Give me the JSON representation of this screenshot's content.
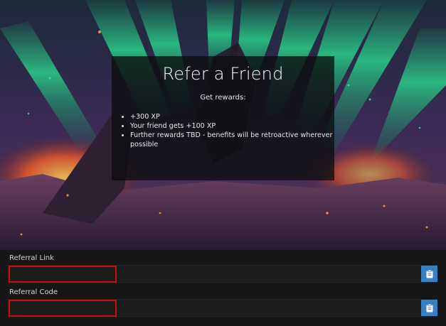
{
  "hero": {
    "card": {
      "title": "Refer a Friend",
      "subtitle": "Get rewards:",
      "rewards": [
        "+300 XP",
        "Your friend gets +100 XP",
        "Further rewards TBD - benefits will be retroactive wherever possible"
      ]
    }
  },
  "referral": {
    "link": {
      "label": "Referral Link",
      "value": "",
      "copy_icon": "clipboard-icon"
    },
    "code": {
      "label": "Referral Code",
      "value": "",
      "copy_icon": "clipboard-icon"
    }
  },
  "colors": {
    "page_background": "#161616",
    "field_background": "#1c1c1c",
    "highlight_border": "#d00c0c",
    "copy_button": "#3a7fc1"
  }
}
